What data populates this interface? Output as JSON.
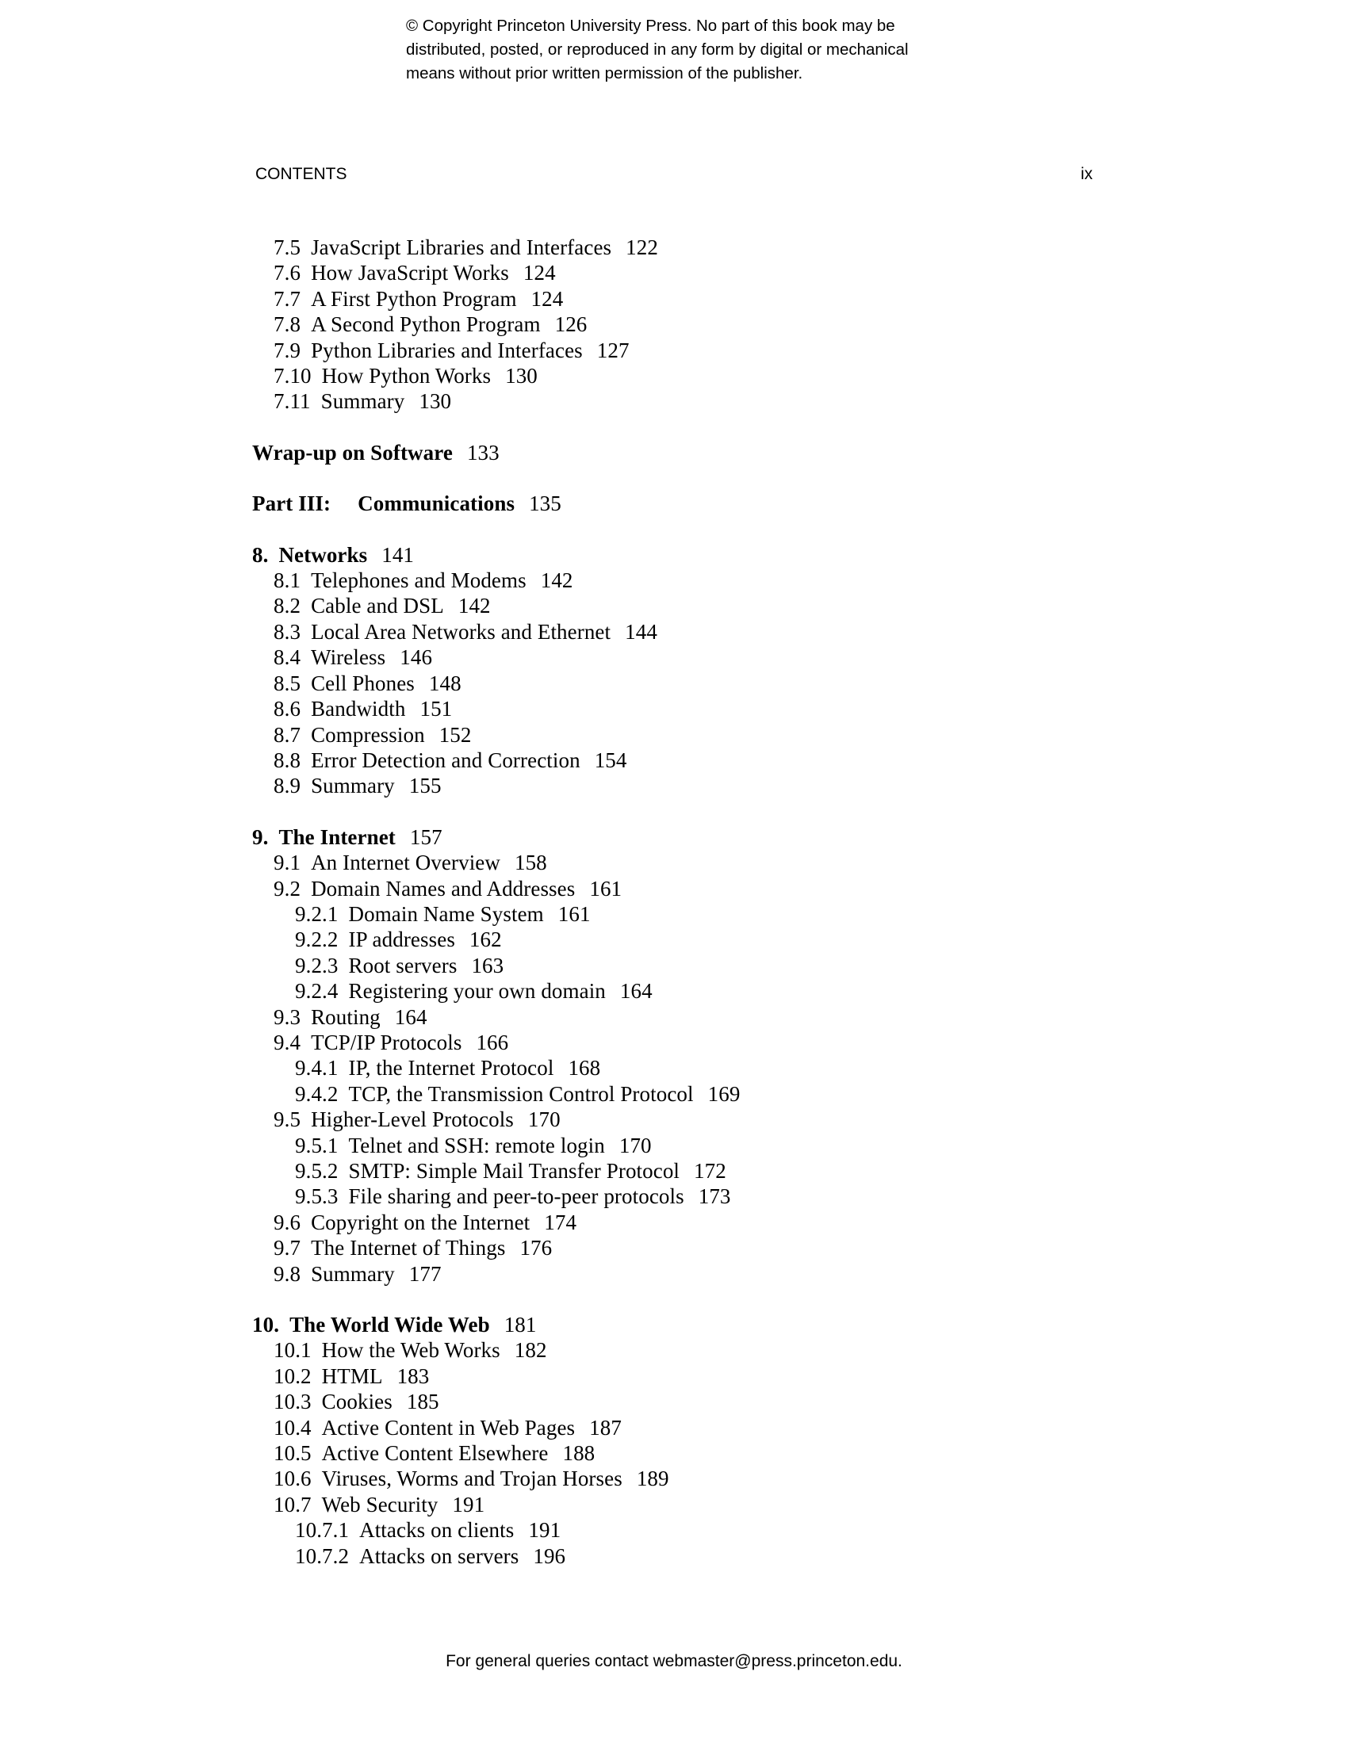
{
  "copyright": {
    "lines": [
      "© Copyright Princeton University Press. No part of this book may be",
      "distributed, posted, or reproduced in any form by digital or mechanical",
      "means without prior written permission of the publisher."
    ]
  },
  "running_head": {
    "title": "CONTENTS",
    "folio": "ix"
  },
  "footer": {
    "text": "For general queries contact webmaster@press.princeton.edu."
  },
  "toc": {
    "groups": [
      {
        "id": "chapter-7-continued",
        "entries": [
          {
            "level": "sec",
            "number": "7.5",
            "title": "JavaScript Libraries and Interfaces",
            "page": "122"
          },
          {
            "level": "sec",
            "number": "7.6",
            "title": "How JavaScript Works",
            "page": "124"
          },
          {
            "level": "sec",
            "number": "7.7",
            "title": "A First Python Program",
            "page": "124"
          },
          {
            "level": "sec",
            "number": "7.8",
            "title": "A Second Python Program",
            "page": "126"
          },
          {
            "level": "sec",
            "number": "7.9",
            "title": "Python Libraries and Interfaces",
            "page": "127"
          },
          {
            "level": "sec",
            "number": "7.10",
            "title": "How Python Works",
            "page": "130"
          },
          {
            "level": "sec",
            "number": "7.11",
            "title": "Summary",
            "page": "130"
          }
        ]
      },
      {
        "id": "wrap-up-on-software",
        "entries": [
          {
            "level": "part",
            "number": "",
            "title": "Wrap-up on Software",
            "page": "133"
          }
        ]
      },
      {
        "id": "part-3",
        "entries": [
          {
            "level": "part",
            "number": "Part III:",
            "title": "Communications",
            "page": "135",
            "wide_gap": true
          }
        ]
      },
      {
        "id": "chapter-8",
        "entries": [
          {
            "level": "chap",
            "number": "8.",
            "title": "Networks",
            "page": "141"
          },
          {
            "level": "sec",
            "number": "8.1",
            "title": "Telephones and Modems",
            "page": "142"
          },
          {
            "level": "sec",
            "number": "8.2",
            "title": "Cable and DSL",
            "page": "142"
          },
          {
            "level": "sec",
            "number": "8.3",
            "title": "Local Area Networks and Ethernet",
            "page": "144"
          },
          {
            "level": "sec",
            "number": "8.4",
            "title": "Wireless",
            "page": "146"
          },
          {
            "level": "sec",
            "number": "8.5",
            "title": "Cell Phones",
            "page": "148"
          },
          {
            "level": "sec",
            "number": "8.6",
            "title": "Bandwidth",
            "page": "151"
          },
          {
            "level": "sec",
            "number": "8.7",
            "title": "Compression",
            "page": "152"
          },
          {
            "level": "sec",
            "number": "8.8",
            "title": "Error Detection and Correction",
            "page": "154"
          },
          {
            "level": "sec",
            "number": "8.9",
            "title": "Summary",
            "page": "155"
          }
        ]
      },
      {
        "id": "chapter-9",
        "entries": [
          {
            "level": "chap",
            "number": "9.",
            "title": "The Internet",
            "page": "157"
          },
          {
            "level": "sec",
            "number": "9.1",
            "title": "An Internet Overview",
            "page": "158"
          },
          {
            "level": "sec",
            "number": "9.2",
            "title": "Domain Names and Addresses",
            "page": "161"
          },
          {
            "level": "sub",
            "number": "9.2.1",
            "title": "Domain Name System",
            "page": "161"
          },
          {
            "level": "sub",
            "number": "9.2.2",
            "title": "IP addresses",
            "page": "162"
          },
          {
            "level": "sub",
            "number": "9.2.3",
            "title": "Root servers",
            "page": "163"
          },
          {
            "level": "sub",
            "number": "9.2.4",
            "title": "Registering your own domain",
            "page": "164"
          },
          {
            "level": "sec",
            "number": "9.3",
            "title": "Routing",
            "page": "164"
          },
          {
            "level": "sec",
            "number": "9.4",
            "title": "TCP/IP Protocols",
            "page": "166"
          },
          {
            "level": "sub",
            "number": "9.4.1",
            "title": "IP, the Internet Protocol",
            "page": "168"
          },
          {
            "level": "sub",
            "number": "9.4.2",
            "title": "TCP, the Transmission Control Protocol",
            "page": "169"
          },
          {
            "level": "sec",
            "number": "9.5",
            "title": "Higher-Level Protocols",
            "page": "170"
          },
          {
            "level": "sub",
            "number": "9.5.1",
            "title": "Telnet and SSH: remote login",
            "page": "170"
          },
          {
            "level": "sub",
            "number": "9.5.2",
            "title": "SMTP: Simple Mail Transfer Protocol",
            "page": "172"
          },
          {
            "level": "sub",
            "number": "9.5.3",
            "title": "File sharing and peer-to-peer protocols",
            "page": "173"
          },
          {
            "level": "sec",
            "number": "9.6",
            "title": "Copyright on the Internet",
            "page": "174"
          },
          {
            "level": "sec",
            "number": "9.7",
            "title": "The Internet of Things",
            "page": "176"
          },
          {
            "level": "sec",
            "number": "9.8",
            "title": "Summary",
            "page": "177"
          }
        ]
      },
      {
        "id": "chapter-10",
        "entries": [
          {
            "level": "chap",
            "number": "10.",
            "title": "The World Wide Web",
            "page": "181"
          },
          {
            "level": "sec",
            "number": "10.1",
            "title": "How the Web Works",
            "page": "182"
          },
          {
            "level": "sec",
            "number": "10.2",
            "title": "HTML",
            "page": "183"
          },
          {
            "level": "sec",
            "number": "10.3",
            "title": "Cookies",
            "page": "185"
          },
          {
            "level": "sec",
            "number": "10.4",
            "title": "Active Content in Web Pages",
            "page": "187"
          },
          {
            "level": "sec",
            "number": "10.5",
            "title": "Active Content Elsewhere",
            "page": "188"
          },
          {
            "level": "sec",
            "number": "10.6",
            "title": "Viruses, Worms and Trojan Horses",
            "page": "189"
          },
          {
            "level": "sec",
            "number": "10.7",
            "title": "Web Security",
            "page": "191"
          },
          {
            "level": "sub",
            "number": "10.7.1",
            "title": "Attacks on clients",
            "page": "191"
          },
          {
            "level": "sub",
            "number": "10.7.2",
            "title": "Attacks on servers",
            "page": "196"
          }
        ]
      }
    ]
  }
}
